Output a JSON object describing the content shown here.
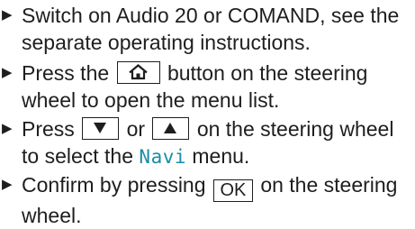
{
  "colors": {
    "text": "#1e1e1e",
    "menu_highlight": "#1a8ca8"
  },
  "steps": [
    {
      "text": "Switch on Audio 20 or COMAND, see the separate operating instructions."
    },
    {
      "before": "Press the",
      "button_icon": "home-icon",
      "after": "button on the steering wheel to open the menu list."
    },
    {
      "before": "Press",
      "button1_icon": "down-arrow-icon",
      "middle": "or",
      "button2_icon": "up-arrow-icon",
      "after": "on the steering wheel to select the",
      "menu_name": "Navi",
      "end": "menu."
    },
    {
      "before": "Confirm by pressing",
      "button_label": "OK",
      "after": "on the steering wheel."
    }
  ]
}
